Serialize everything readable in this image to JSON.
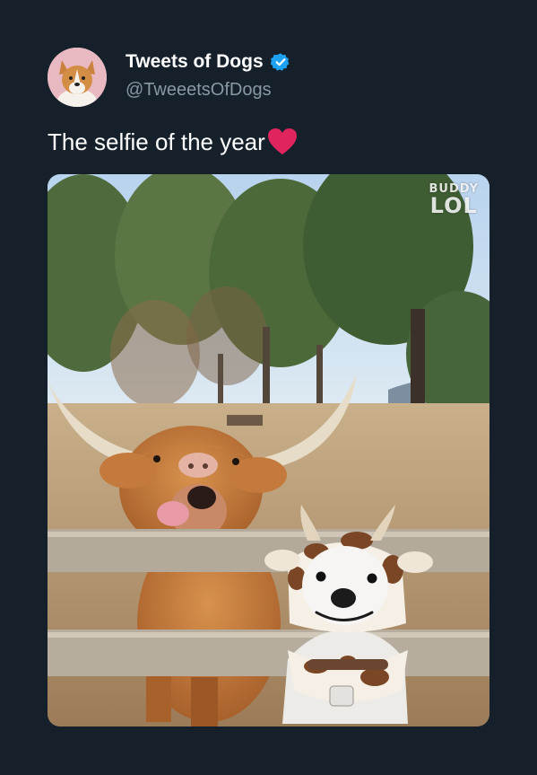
{
  "tweet": {
    "display_name": "Tweets of Dogs",
    "handle": "@TweeetsOfDogs",
    "text": "The selfie of the year",
    "verified": true
  },
  "media": {
    "watermark_top": "BUDDY",
    "watermark_bottom": "LOL",
    "tag_text": "BUDDY"
  },
  "icons": {
    "verified": "verified-badge-icon",
    "heart": "red-heart-emoji"
  },
  "colors": {
    "background": "#15202b",
    "text": "#ffffff",
    "secondary_text": "#8899a6",
    "verified_blue": "#1da1f2",
    "heart_red": "#e0245e"
  }
}
